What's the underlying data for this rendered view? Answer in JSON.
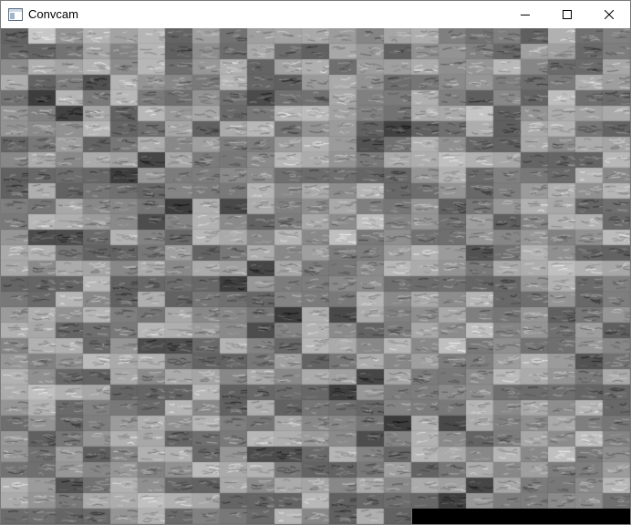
{
  "window": {
    "title": "Convcam"
  },
  "icons": {
    "app": "app-window-icon",
    "minimize": "minimize-icon",
    "maximize": "maximize-icon",
    "close": "close-icon"
  },
  "colors": {
    "titlebar_bg": "#ffffff",
    "title_text": "#000000",
    "canvas_base": "#808080",
    "strip": "#000000"
  }
}
